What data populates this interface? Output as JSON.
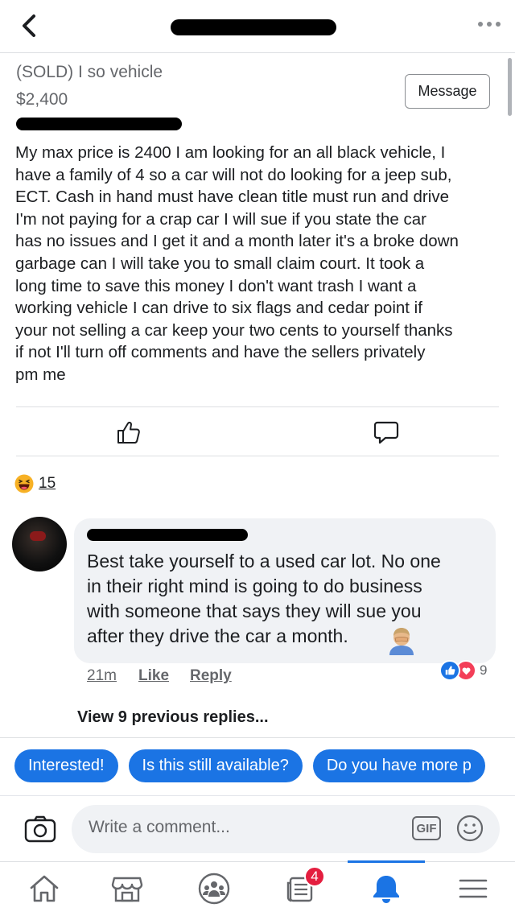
{
  "post": {
    "title": "(SOLD) I so vehicle",
    "price": "$2,400",
    "message_button": "Message",
    "body": "My max price is 2400 I am looking for an all black vehicle,  I\nhave a family of 4 so a car will not do looking for a jeep sub,\nECT. Cash in hand must have clean title must run and drive\nI'm not paying for a crap car I will sue  if you state the car\nhas no issues and I get it and a month later it's a broke down\ngarbage can I will take you to small claim court. It took a\nlong time to save this money I don't want trash I want a\nworking vehicle  I can drive to six flags and cedar point if\nyour not selling a car keep your two cents to yourself thanks\nif not I'll turn off comments and have the sellers privately\npm me"
  },
  "reactions": {
    "type": "haha",
    "count": "15"
  },
  "comment": {
    "text": "Best take yourself to a used car lot.  No one\nin their right mind is going to do business\nwith someone that says they will sue you\nafter they drive the car a month.",
    "time": "21m",
    "like_label": "Like",
    "reply_label": "Reply",
    "reaction_icons": [
      "like",
      "love"
    ],
    "reaction_count": "9"
  },
  "view_replies": "View 9 previous replies...",
  "quick_replies": [
    "Interested!",
    "Is this still available?",
    "Do you have more p"
  ],
  "composer": {
    "placeholder": "Write a comment...",
    "gif_label": "GIF"
  },
  "bottom_nav": {
    "items": [
      "home-icon",
      "marketplace-icon",
      "groups-icon",
      "news-icon",
      "notifications-icon",
      "menu-icon"
    ],
    "active": "notifications-icon",
    "news_badge": "4"
  },
  "colors": {
    "accent": "#1b74e4",
    "badge": "#e41e3f",
    "text": "#1c1e21",
    "secondary_text": "#65676b"
  }
}
